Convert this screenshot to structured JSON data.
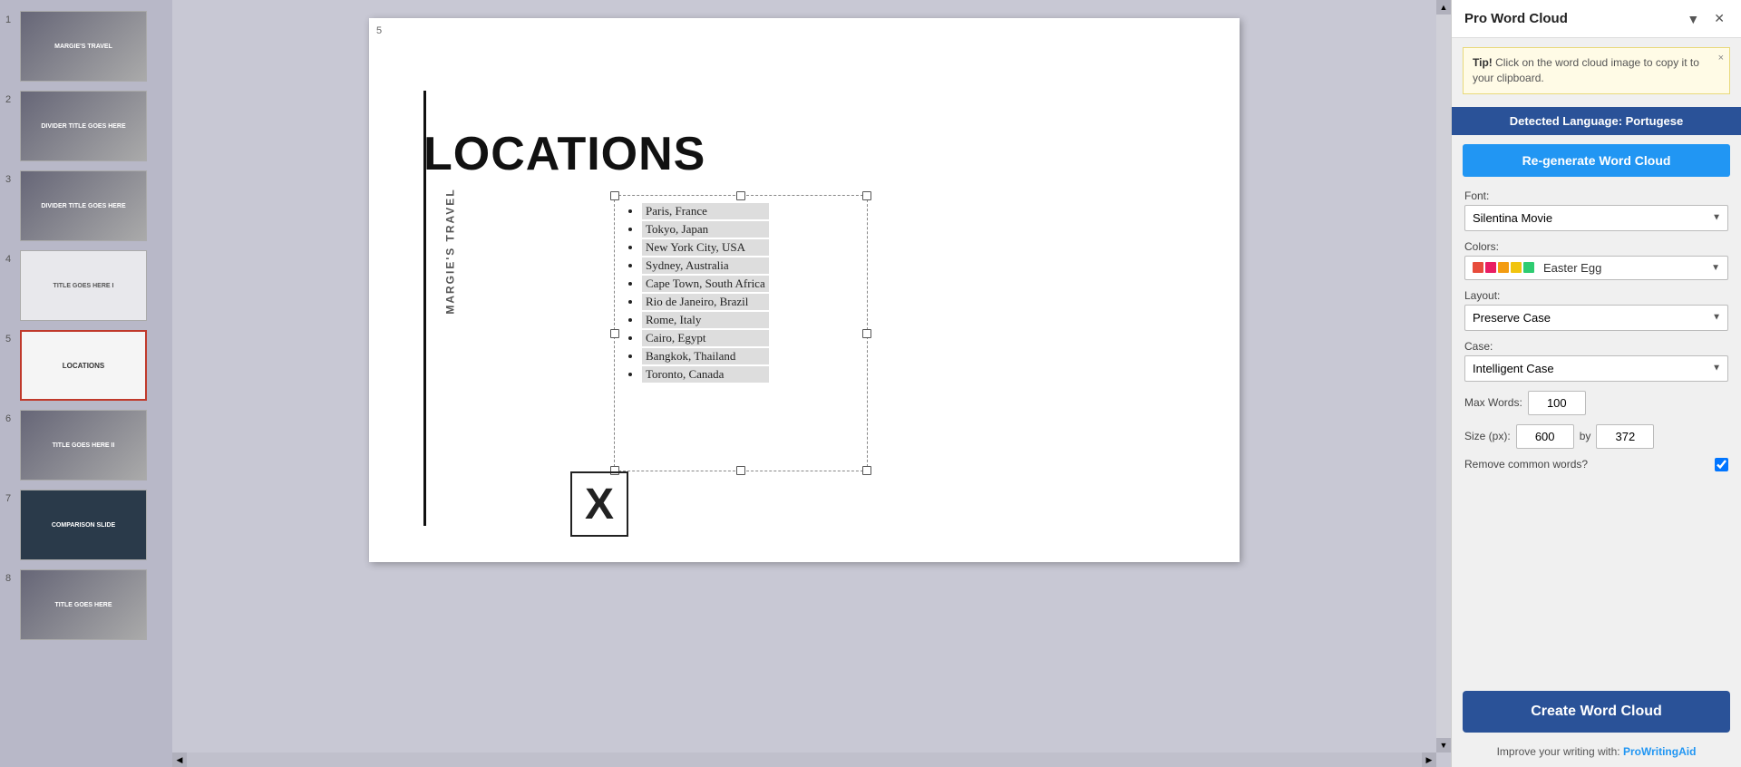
{
  "app": {
    "title": "Pro Word Cloud",
    "tip_text": " Click on the word cloud image to copy it to your clipboard.",
    "tip_bold": "Tip!",
    "close_x": "×"
  },
  "language_bar": {
    "label": "Detected Language: Portugese"
  },
  "buttons": {
    "regenerate": "Re-generate Word Cloud",
    "create": "Create Word Cloud"
  },
  "settings": {
    "font_label": "Font:",
    "font_value": "Silentina Movie",
    "colors_label": "Colors:",
    "colors_value": "Easter Egg",
    "layout_label": "Layout:",
    "layout_value": "Preserve Case",
    "case_label": "Case:",
    "case_value": "Intelligent Case",
    "max_words_label": "Max Words:",
    "max_words_value": "100",
    "size_label": "Size (px):",
    "size_w": "600",
    "size_h": "372",
    "size_by": "by",
    "remove_common_label": "Remove common words?",
    "remove_common_checked": true
  },
  "footer": {
    "text": "Improve your writing with: ",
    "link_label": "ProWritingAid"
  },
  "thumbnails": [
    {
      "number": "1",
      "label": "MARGIE'S\nTRAVEL",
      "style": "img"
    },
    {
      "number": "2",
      "label": "DIVIDER TITLE\nGOES HERE",
      "style": "img"
    },
    {
      "number": "3",
      "label": "DIVIDER TITLE\nGOES HERE",
      "style": "img"
    },
    {
      "number": "4",
      "label": "TITLE GOES\nHERE I",
      "style": "normal"
    },
    {
      "number": "5",
      "label": "LOCATIONS",
      "style": "active"
    },
    {
      "number": "6",
      "label": "TITLE GOES\nHERE II",
      "style": "img"
    },
    {
      "number": "7",
      "label": "COMPARISON SLIDE",
      "style": "dark"
    },
    {
      "number": "8",
      "label": "TITLE GOES\nHERE",
      "style": "img"
    }
  ],
  "slide": {
    "page_num": "5",
    "title": "LOCATIONS",
    "vertical_text": "MARGIE'S TRAVEL",
    "locations": [
      "Paris, France",
      "Tokyo, Japan",
      "New York City, USA",
      "Sydney, Australia",
      "Cape Town, South Africa",
      "Rio de Janeiro, Brazil",
      "Rome, Italy",
      "Cairo, Egypt",
      "Bangkok, Thailand",
      "Toronto, Canada"
    ],
    "x_symbol": "X"
  },
  "swatches": [
    "#e74c3c",
    "#e91e63",
    "#f39c12",
    "#f1c40f",
    "#2ecc71"
  ],
  "chevron": "▼"
}
